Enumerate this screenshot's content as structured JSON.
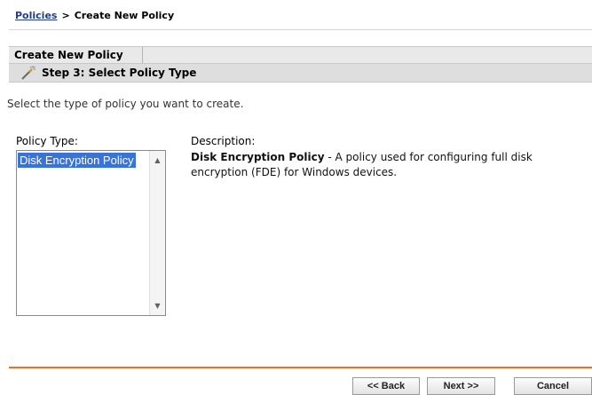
{
  "breadcrumb": {
    "link": "Policies",
    "separator": ">",
    "current": "Create New Policy"
  },
  "header": {
    "tab_label": "Create New Policy",
    "step_title": "Step 3: Select Policy Type",
    "step_icon": "wand-icon"
  },
  "instruction": "Select the type of policy you want to create.",
  "policy_type": {
    "label": "Policy Type:",
    "items": [
      "Disk Encryption Policy"
    ],
    "selected": "Disk Encryption Policy"
  },
  "description": {
    "label": "Description:",
    "title": "Disk Encryption Policy",
    "text": " - A policy used for configuring full disk encryption (FDE) for Windows devices."
  },
  "buttons": {
    "back": "<< Back",
    "next": "Next >>",
    "cancel": "Cancel"
  },
  "colors": {
    "selection": "#3874d8",
    "accent_rule": "#ee6e2e",
    "link": "#1f3d8c"
  }
}
